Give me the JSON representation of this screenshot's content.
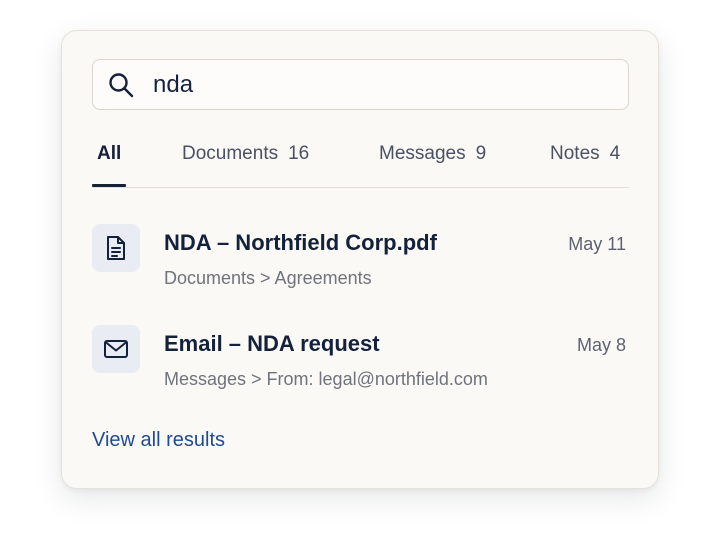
{
  "search": {
    "value": "nda",
    "icon": "search-icon"
  },
  "tabs": [
    {
      "label": "All",
      "count": "",
      "active": true
    },
    {
      "label": "Documents",
      "count": "16",
      "active": false
    },
    {
      "label": "Messages",
      "count": "9",
      "active": false
    },
    {
      "label": "Notes",
      "count": "4",
      "active": false
    }
  ],
  "results": [
    {
      "icon": "document-icon",
      "title": "NDA – Northfield Corp.pdf",
      "path": "Documents > Agreements",
      "date": "May 11"
    },
    {
      "icon": "mail-icon",
      "title": "Email – NDA request",
      "path": "Messages > From: legal@northfield.com",
      "date": "May 8"
    }
  ],
  "footer": {
    "view_all_label": "View all results"
  },
  "colors": {
    "text_primary": "#14213a",
    "link": "#1f4b8e",
    "panel_bg": "#fbf9f6",
    "icon_tile_bg": "#e9ecf3"
  }
}
